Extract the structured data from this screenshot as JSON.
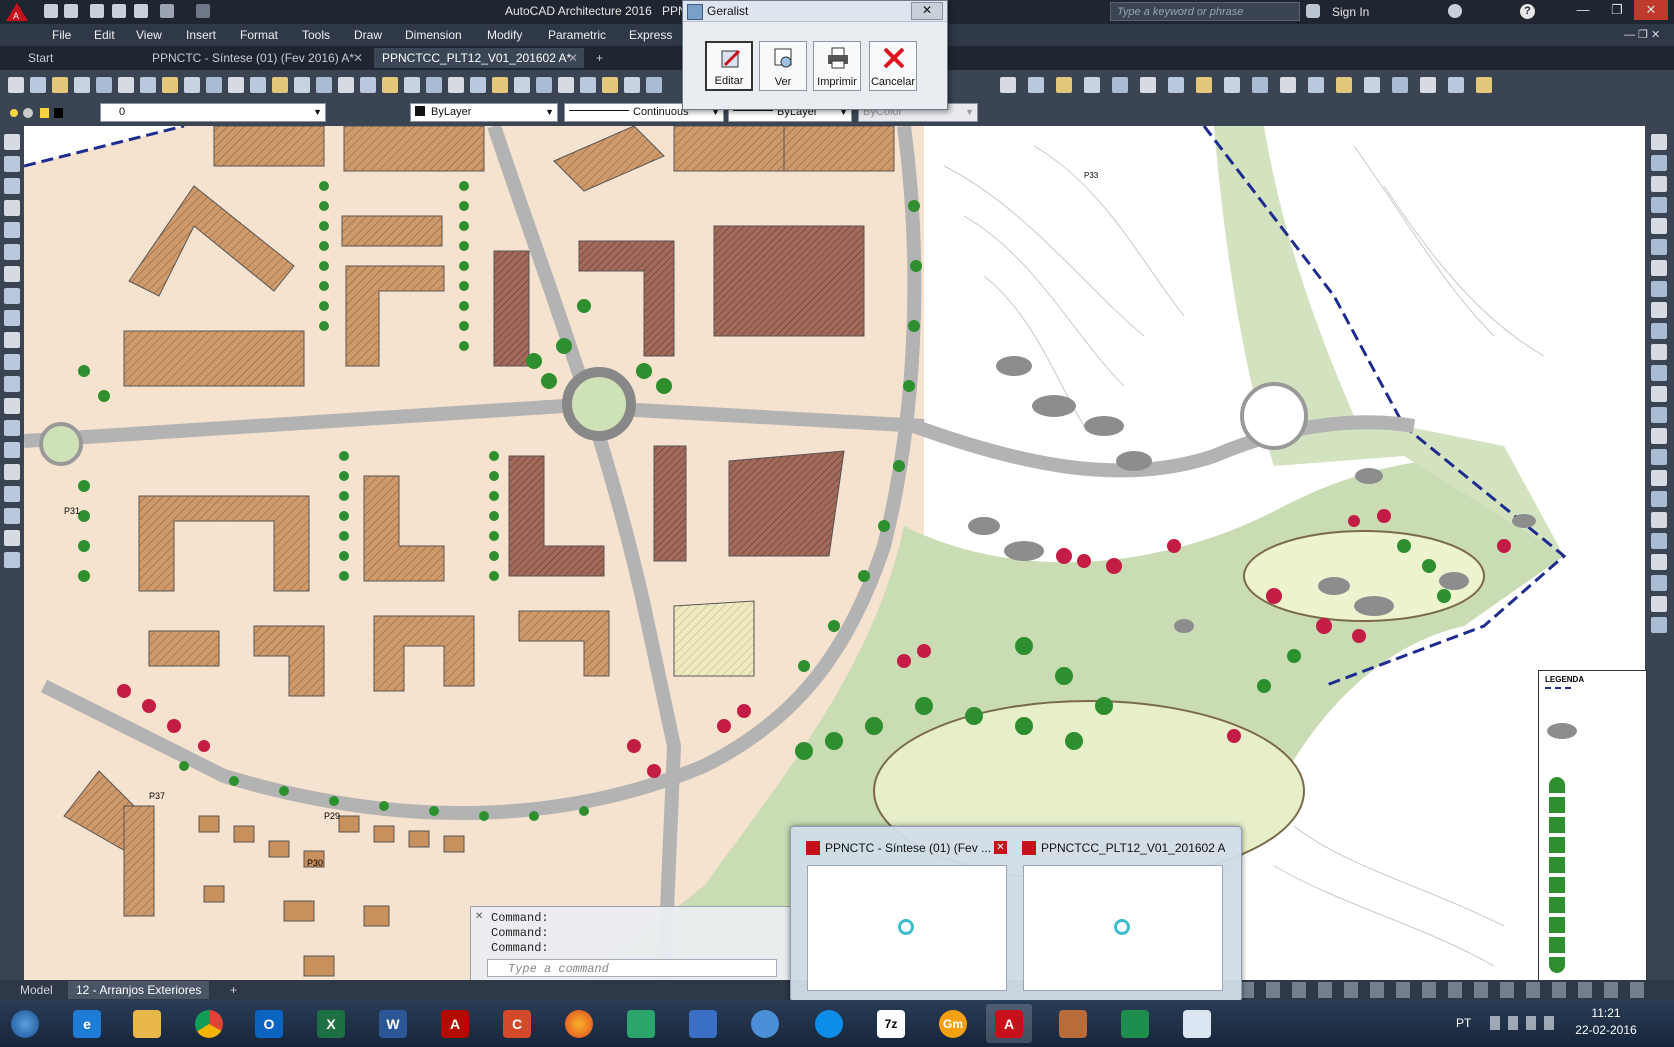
{
  "titlebar": {
    "app_title": "AutoCAD Architecture 2016",
    "file_fragment": "PPN",
    "search_placeholder": "Type a keyword or phrase",
    "signin_label": "Sign In"
  },
  "menubar": {
    "items": [
      "File",
      "Edit",
      "View",
      "Insert",
      "Format",
      "Tools",
      "Draw",
      "Dimension",
      "Modify",
      "Parametric",
      "Express"
    ]
  },
  "file_tabs": [
    {
      "label": "Start",
      "active": false
    },
    {
      "label": "PPNCTC - Síntese (01)  (Fev 2016) A*",
      "active": false
    },
    {
      "label": "PPNCTCC_PLT12_V01_201602 A*",
      "active": true
    }
  ],
  "layer_toolbar": {
    "layer_value": "0",
    "color_value": "ByLayer",
    "linetype_value": "Continuous",
    "lineweight_value": "ByLayer",
    "plotstyle_value": "ByColor"
  },
  "geralist": {
    "title": "Geralist",
    "buttons": [
      "Editar",
      "Ver",
      "Imprimir",
      "Cancelar"
    ]
  },
  "command_line": {
    "history": [
      "Command:",
      "Command:",
      "Command:"
    ],
    "placeholder": "Type a command"
  },
  "layout_tabs": [
    {
      "label": "Model",
      "active": false
    },
    {
      "label": "12 - Arranjos Exteriores",
      "active": true
    },
    {
      "label": "+",
      "active": false
    }
  ],
  "thumbnail_popup": {
    "items": [
      "PPNCTC - Síntese (01)  (Fev ...",
      "PPNCTCC_PLT12_V01_201602 A..."
    ]
  },
  "map_labels": {
    "p31": "P31",
    "p37": "P37",
    "p29": "P29",
    "p30": "P30",
    "p33": "P33",
    "legend_title": "LEGENDA"
  },
  "taskbar": {
    "apps": [
      "start",
      "ie",
      "explorer",
      "chrome",
      "outlook",
      "excel",
      "word",
      "acrobat",
      "ccleaner",
      "firefox",
      "app-green",
      "save",
      "globe",
      "teamviewer",
      "7z",
      "gm",
      "autocad",
      "house",
      "app-list",
      "folder"
    ],
    "language": "PT",
    "time": "11:21",
    "date": "22-02-2016"
  },
  "colors": {
    "accent_autocad": "#c8101a",
    "block_orange": "#cf9a6b",
    "block_brown": "#a26a5a",
    "tree_green": "#2e8f2e",
    "park_green": "#c9dcb4",
    "flower_red": "#c41d45"
  }
}
